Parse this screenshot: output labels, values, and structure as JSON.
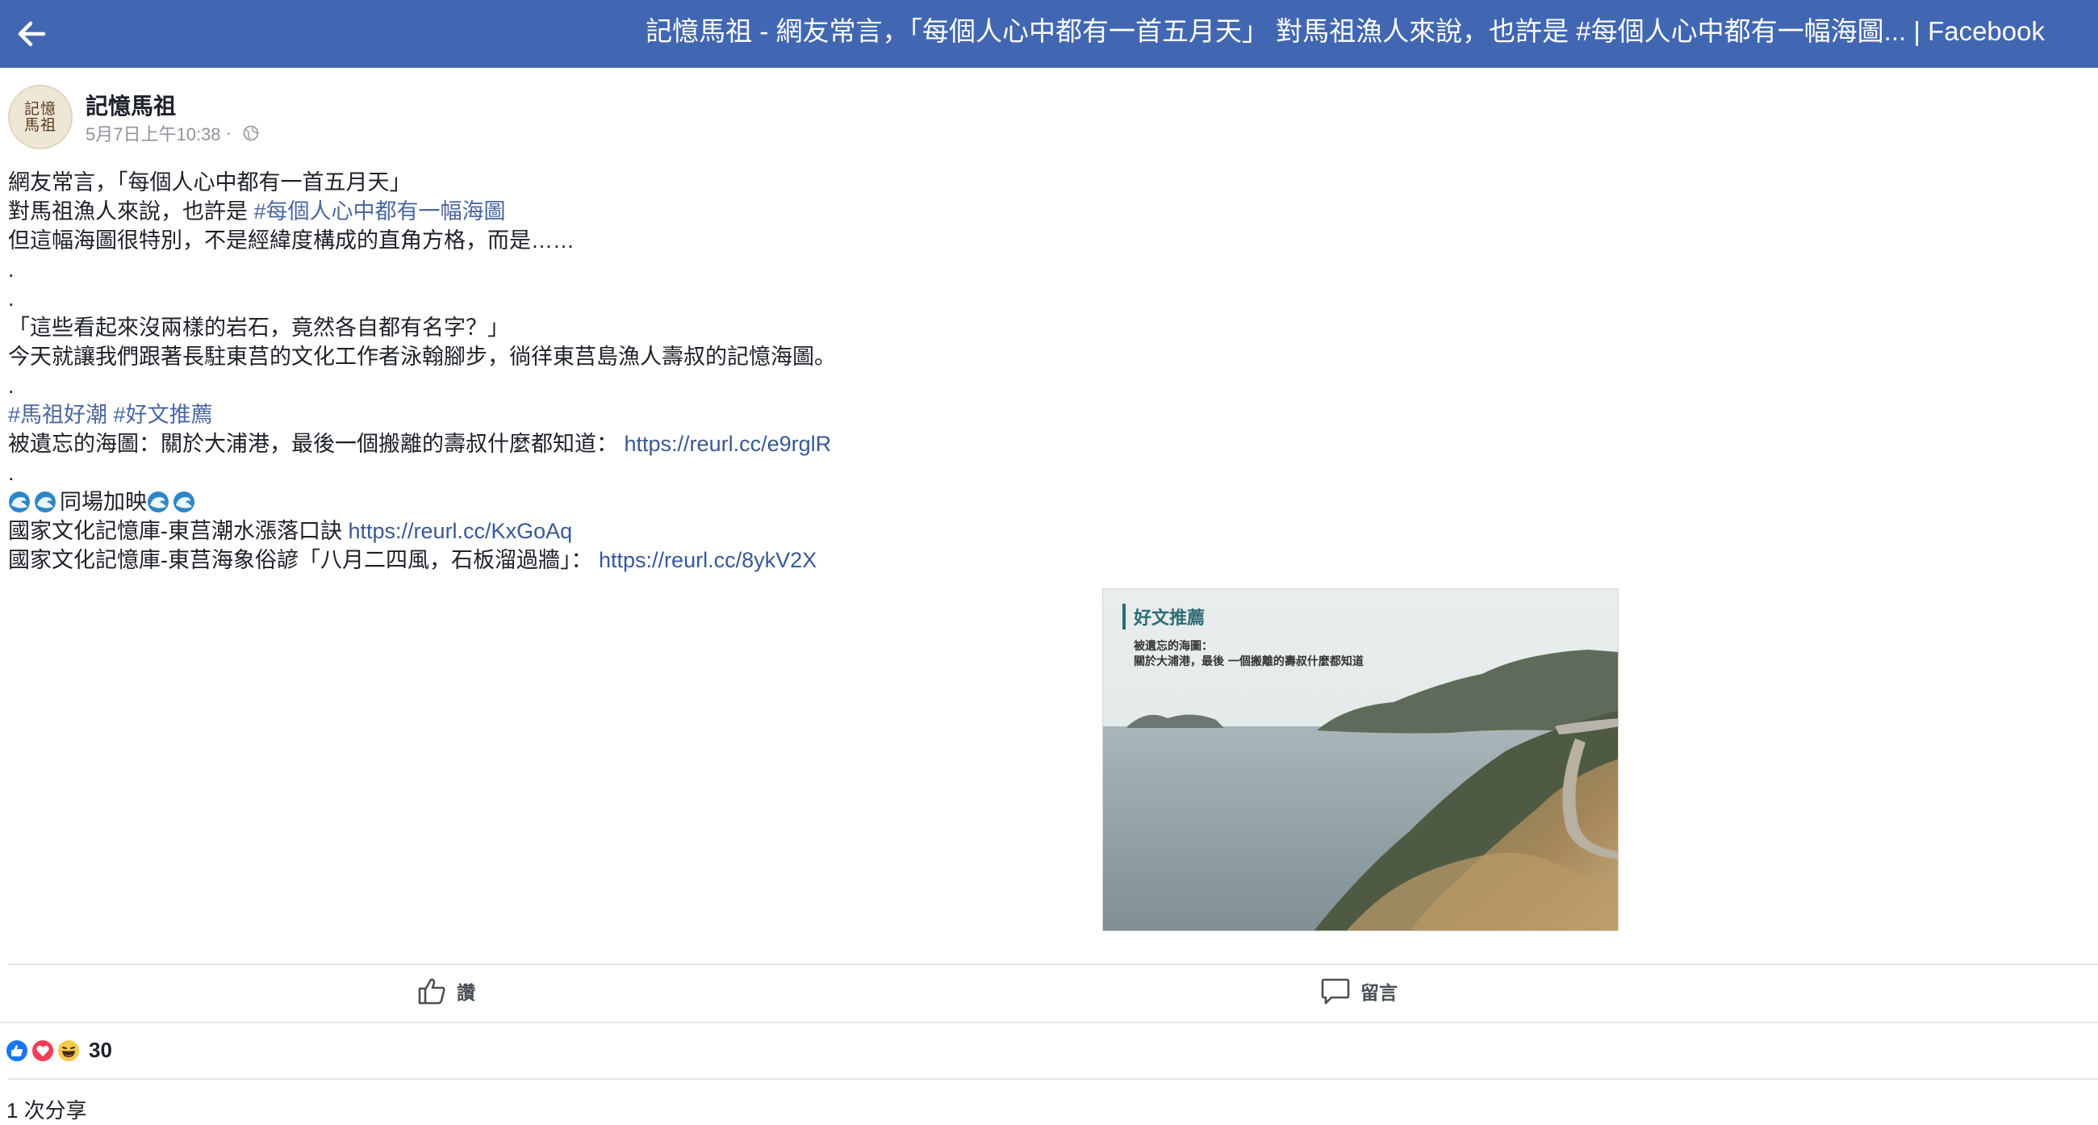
{
  "header": {
    "title": "記憶馬祖 - 網友常言，「每個人心中都有一首五月天」 對馬祖漁人來說，也許是 #每個人心中都有一幅海圖... | Facebook"
  },
  "post": {
    "page_name": "記憶馬祖",
    "avatar_text": [
      "記憶",
      "馬祖"
    ],
    "timestamp": "5月7日上午10:38",
    "separator": " · ",
    "lines": {
      "l1": "網友常言，「每個人心中都有一首五月天」",
      "l2_text": "對馬祖漁人來說，也許是 ",
      "l2_tag": "#每個人心中都有一幅海圖",
      "l3": "但這幅海圖很特別，不是經緯度構成的直角方格，而是……",
      "dot": ".",
      "l6": "「這些看起來沒兩樣的岩石，竟然各自都有名字？」",
      "l7": "今天就讓我們跟著長駐東莒的文化工作者泳翰腳步，徜徉東莒島漁人壽叔的記憶海圖。",
      "tag1": "#馬祖好潮",
      "tag2": "#好文推薦",
      "l10_text": "被遺忘的海圖：關於大浦港，最後一個搬離的壽叔什麼都知道：",
      "l10_link": "https://reurl.cc/e9rglR",
      "l12_text": "同場加映",
      "l13_text": "國家文化記憶庫-東莒潮水漲落口訣 ",
      "l13_link": "https://reurl.cc/KxGoAq",
      "l14_text": "國家文化記憶庫-東莒海象俗諺「八月二四風，石板溜過牆」：",
      "l14_link": "https://reurl.cc/8ykV2X"
    },
    "image": {
      "heading": "好文推薦",
      "sub1": "被遺忘的海圖：",
      "sub2": "關於大浦港，最後 一個搬離的壽叔什麼都知道"
    }
  },
  "actions": {
    "like_label": "讚",
    "comment_label": "留言"
  },
  "engagement": {
    "reaction_icons": [
      "like-icon",
      "love-icon",
      "haha-icon"
    ],
    "reaction_count": "30",
    "shares": "1 次分享"
  },
  "colors": {
    "topbar": "#4267b2",
    "link": "#385898",
    "hashtag": "#4b67a1"
  }
}
